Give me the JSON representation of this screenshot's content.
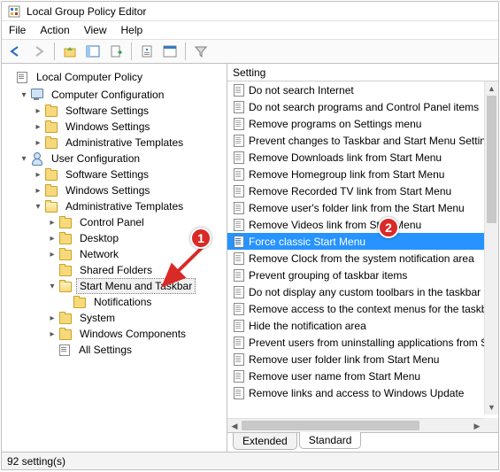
{
  "window": {
    "title": "Local Group Policy Editor"
  },
  "menu": {
    "file": "File",
    "action": "Action",
    "view": "View",
    "help": "Help"
  },
  "tree": {
    "root": "Local Computer Policy",
    "cc": {
      "label": "Computer Configuration",
      "sw": "Software Settings",
      "ws": "Windows Settings",
      "at": "Administrative Templates"
    },
    "uc": {
      "label": "User Configuration",
      "sw": "Software Settings",
      "ws": "Windows Settings",
      "at": {
        "label": "Administrative Templates",
        "cp": "Control Panel",
        "dk": "Desktop",
        "nw": "Network",
        "sf": "Shared Folders",
        "smt": {
          "label": "Start Menu and Taskbar",
          "nt": "Notifications"
        },
        "sys": "System",
        "wc": "Windows Components",
        "as": "All Settings"
      }
    }
  },
  "list": {
    "header": "Setting",
    "items": [
      "Do not search Internet",
      "Do not search programs and Control Panel items",
      "Remove programs on Settings menu",
      "Prevent changes to Taskbar and Start Menu Settings",
      "Remove Downloads link from Start Menu",
      "Remove Homegroup link from Start Menu",
      "Remove Recorded TV link from Start Menu",
      "Remove user's folder link from the Start Menu",
      "Remove Videos link from Start Menu",
      "Force classic Start Menu",
      "Remove Clock from the system notification area",
      "Prevent grouping of taskbar items",
      "Do not display any custom toolbars in the taskbar",
      "Remove access to the context menus for the taskbar",
      "Hide the notification area",
      "Prevent users from uninstalling applications from Start",
      "Remove user folder link from Start Menu",
      "Remove user name from Start Menu",
      "Remove links and access to Windows Update"
    ],
    "selected_index": 9
  },
  "tabs": {
    "extended": "Extended",
    "standard": "Standard"
  },
  "status": {
    "text": "92 setting(s)"
  },
  "annotations": {
    "one": "1",
    "two": "2"
  }
}
